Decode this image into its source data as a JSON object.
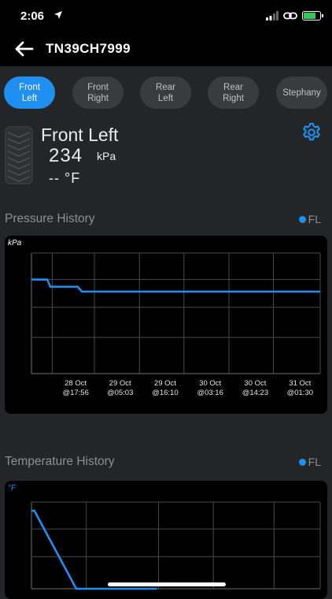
{
  "status_bar": {
    "time": "2:06"
  },
  "header": {
    "title": "TN39CH7999"
  },
  "tabs": [
    {
      "label": "Front\nLeft",
      "active": true
    },
    {
      "label": "Front\nRight",
      "active": false
    },
    {
      "label": "Rear\nLeft",
      "active": false
    },
    {
      "label": "Rear\nRight",
      "active": false
    },
    {
      "label": "Stephany",
      "active": false
    }
  ],
  "tire": {
    "name": "Front Left",
    "pressure": "234",
    "pressure_unit": "kPa",
    "temperature": "-- °F"
  },
  "pressure_history": {
    "title": "Pressure History",
    "legend": "FL",
    "unit_label": "kPa",
    "ticks": [
      "28 Oct\n@17:56",
      "29 Oct\n@05:03",
      "29 Oct\n@16:10",
      "30 Oct\n@03:16",
      "30 Oct\n@14:23",
      "31 Oct\n@01:30"
    ]
  },
  "temperature_history": {
    "title": "Temperature History",
    "legend": "FL",
    "unit_label": "°F"
  },
  "colors": {
    "accent": "#1f8ff2",
    "background": "#242526",
    "card": "#000000",
    "tab_inactive": "#3a3b3e"
  },
  "chart_data": [
    {
      "type": "line",
      "title": "Pressure History",
      "ylabel": "kPa",
      "x_tick_labels": [
        "28 Oct @17:56",
        "29 Oct @05:03",
        "29 Oct @16:10",
        "30 Oct @03:16",
        "30 Oct @14:23",
        "31 Oct @01:30"
      ],
      "series": [
        {
          "name": "FL",
          "x_fraction": [
            0.0,
            0.055,
            0.06,
            0.065,
            0.16,
            0.175,
            1.0
          ],
          "y_fraction": [
            0.78,
            0.78,
            0.75,
            0.72,
            0.72,
            0.68,
            0.68
          ]
        }
      ],
      "grid": true
    },
    {
      "type": "line",
      "title": "Temperature History",
      "ylabel": "°F",
      "series": [
        {
          "name": "FL",
          "x_fraction": [
            0.0,
            0.01,
            0.155,
            0.435
          ],
          "y_fraction": [
            0.9,
            0.9,
            0.0,
            0.0
          ]
        }
      ],
      "grid": true
    }
  ]
}
